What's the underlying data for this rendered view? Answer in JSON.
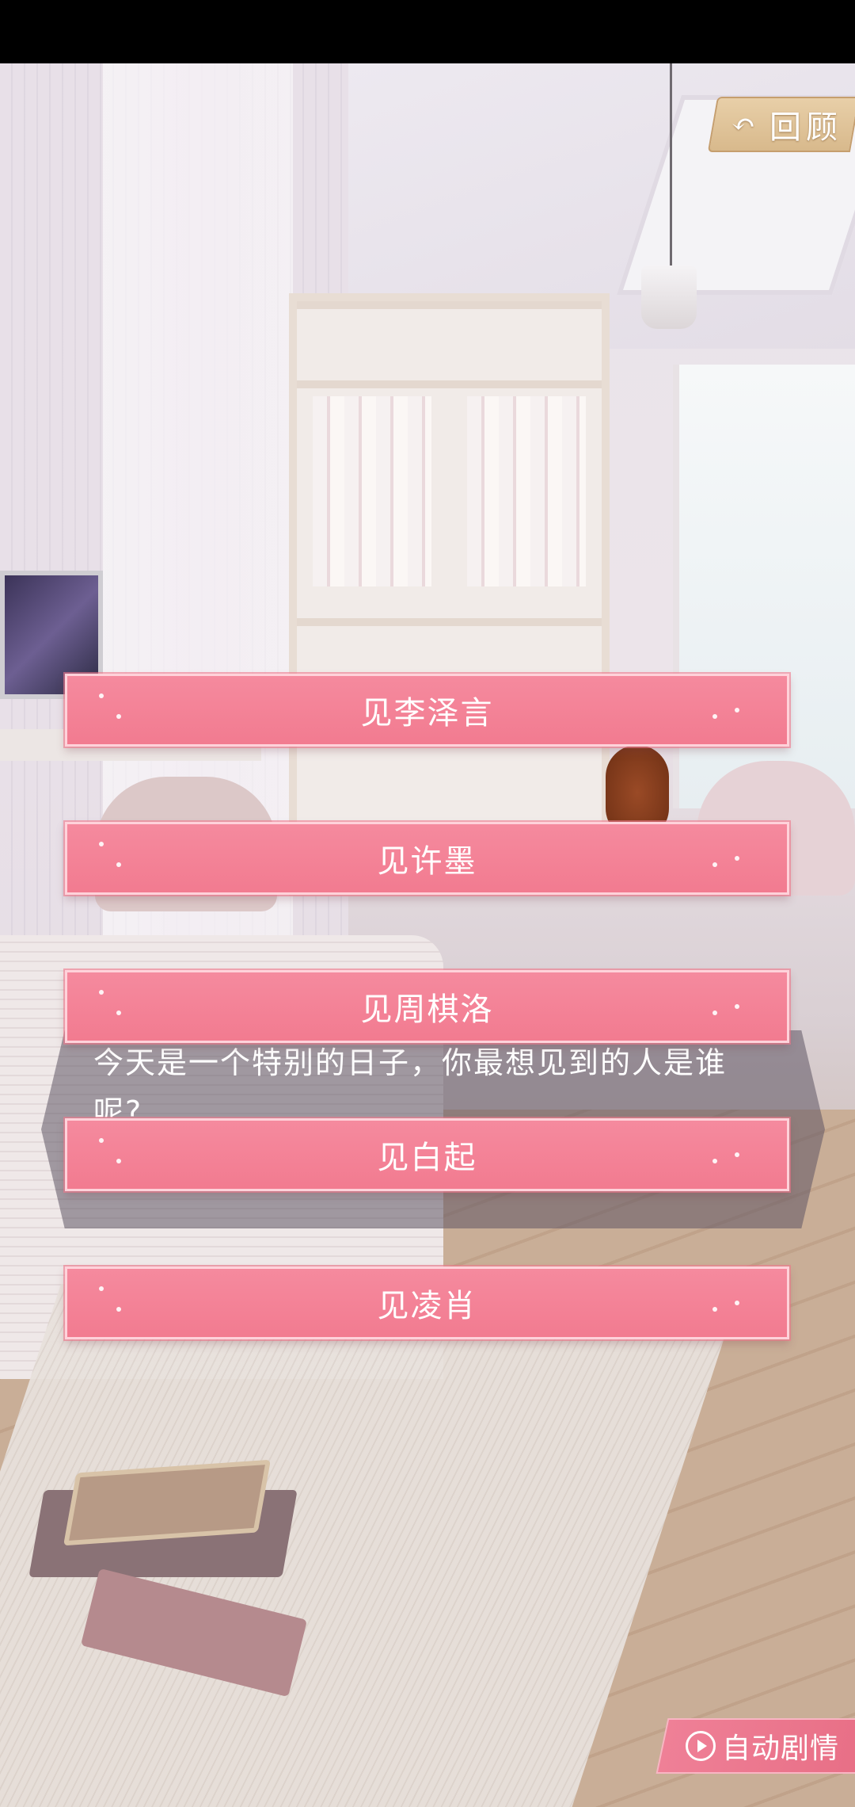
{
  "header": {
    "back_label": "回顾",
    "back_icon": "undo-arrow-icon"
  },
  "dialog": {
    "text": "今天是一个特别的日子，你最想见到的人是谁呢?"
  },
  "choices": [
    {
      "label": "见李泽言"
    },
    {
      "label": "见许墨"
    },
    {
      "label": "见周棋洛"
    },
    {
      "label": "见白起"
    },
    {
      "label": "见凌肖"
    }
  ],
  "footer": {
    "auto_label": "自动剧情",
    "auto_icon": "play-circle-icon"
  },
  "colors": {
    "choice_bg": "#f27b90",
    "back_bg": "#d8b98c",
    "dialog_bg": "#5f5564"
  }
}
